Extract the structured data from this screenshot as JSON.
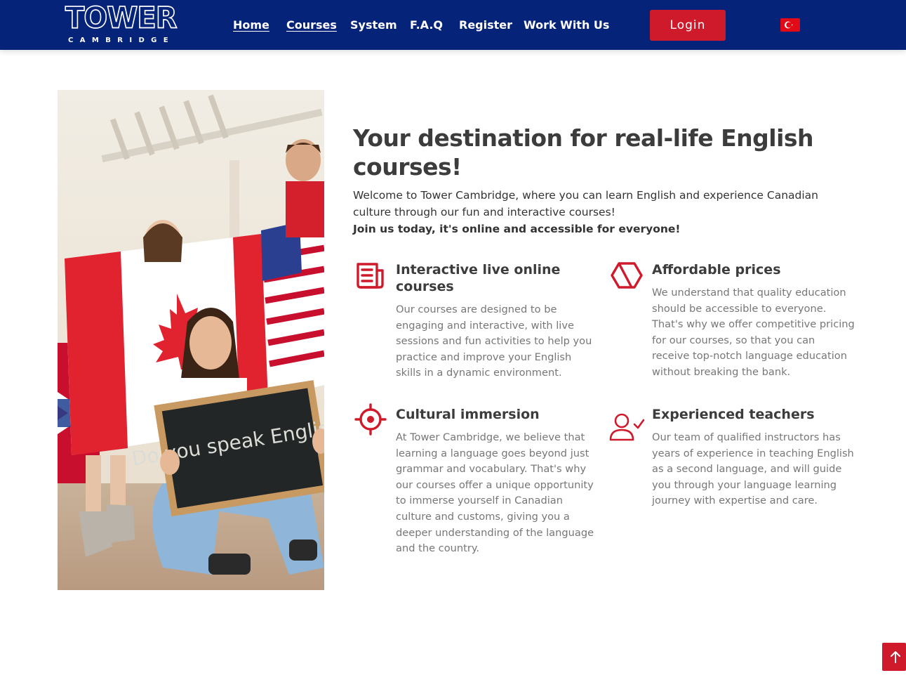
{
  "brand": {
    "logo_word": "TOWER",
    "logo_sub": "CAMBRIDGE",
    "accent_color": "#cf1a2c",
    "header_color": "#06237a"
  },
  "nav": {
    "items": [
      {
        "label": "Home"
      },
      {
        "label": "Courses"
      },
      {
        "label": "System"
      },
      {
        "label": "F.A.Q"
      },
      {
        "label": "Register"
      },
      {
        "label": "Work With Us"
      }
    ],
    "login_label": "Login",
    "language_flag": "turkey-flag-icon"
  },
  "hero": {
    "photo_sign_text": "Do you speak English?",
    "headline": "Your destination for real-life English courses!",
    "intro": "Welcome to Tower Cambridge, where you can learn English and experience Canadian culture through our fun and interactive courses!",
    "intro_bold": "Join us today, it's online and accessible for everyone!"
  },
  "features": [
    {
      "icon": "newspaper-icon",
      "title": "Interactive live online courses",
      "text": "Our courses are designed to be engaging and interactive, with live sessions and fun activities to help you practice and improve your English skills in a dynamic environment."
    },
    {
      "icon": "hexagon-icon",
      "title": "Affordable prices",
      "text": "We understand that quality education should be accessible to everyone. That's why we offer competitive pricing for our courses, so that you can receive top-notch language education without breaking the bank."
    },
    {
      "icon": "target-icon",
      "title": "Cultural immersion",
      "text": "At Tower Cambridge, we believe that learning a language goes beyond just grammar and vocabulary. That's why our courses offer a unique opportunity to immerse yourself in Canadian culture and customs, giving you a deeper understanding of the language and the country."
    },
    {
      "icon": "user-check-icon",
      "title": "Experienced teachers",
      "text": "Our team of qualified instructors has years of experience in teaching English as a second language, and will guide you through your language learning journey with expertise and care."
    }
  ],
  "scroll_top_icon": "arrow-up-icon"
}
